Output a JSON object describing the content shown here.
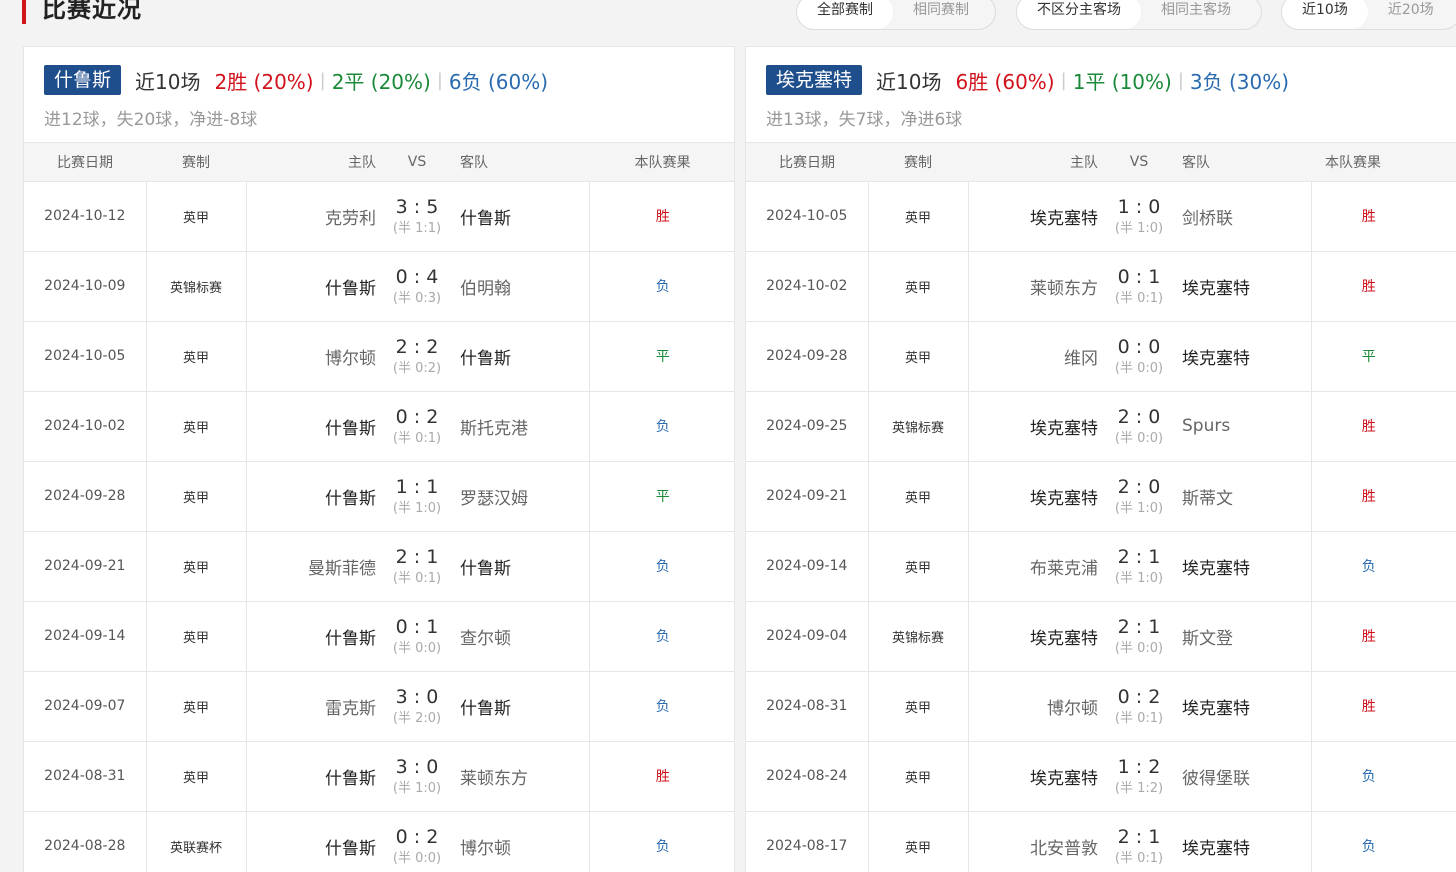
{
  "section_title": "比赛近况",
  "filters": [
    {
      "options": [
        "全部赛制",
        "相同赛制"
      ],
      "active": 0
    },
    {
      "options": [
        "不区分主客场",
        "相同主客场"
      ],
      "active": 0
    },
    {
      "options": [
        "近10场",
        "近20场"
      ],
      "active": 0
    }
  ],
  "columns": {
    "date": "比赛日期",
    "competition": "赛制",
    "home": "主队",
    "vs": "VS",
    "away": "客队",
    "result": "本队赛果"
  },
  "panels": [
    {
      "team": "什鲁斯",
      "games_label": "近10场",
      "wins": "2胜 (20%)",
      "draws": "2平 (20%)",
      "losses": "6负 (60%)",
      "goals": "进12球，失20球，净进-8球",
      "matches": [
        {
          "date": "2024-10-12",
          "comp": "英甲",
          "home": "克劳利",
          "score": "3 : 5",
          "half": "(半 1:1)",
          "away": "什鲁斯",
          "result": "胜",
          "r": "W",
          "self": "away"
        },
        {
          "date": "2024-10-09",
          "comp": "英锦标赛",
          "home": "什鲁斯",
          "score": "0 : 4",
          "half": "(半 0:3)",
          "away": "伯明翰",
          "result": "负",
          "r": "L",
          "self": "home"
        },
        {
          "date": "2024-10-05",
          "comp": "英甲",
          "home": "博尔顿",
          "score": "2 : 2",
          "half": "(半 0:2)",
          "away": "什鲁斯",
          "result": "平",
          "r": "D",
          "self": "away"
        },
        {
          "date": "2024-10-02",
          "comp": "英甲",
          "home": "什鲁斯",
          "score": "0 : 2",
          "half": "(半 0:1)",
          "away": "斯托克港",
          "result": "负",
          "r": "L",
          "self": "home"
        },
        {
          "date": "2024-09-28",
          "comp": "英甲",
          "home": "什鲁斯",
          "score": "1 : 1",
          "half": "(半 1:0)",
          "away": "罗瑟汉姆",
          "result": "平",
          "r": "D",
          "self": "home"
        },
        {
          "date": "2024-09-21",
          "comp": "英甲",
          "home": "曼斯菲德",
          "score": "2 : 1",
          "half": "(半 0:1)",
          "away": "什鲁斯",
          "result": "负",
          "r": "L",
          "self": "away"
        },
        {
          "date": "2024-09-14",
          "comp": "英甲",
          "home": "什鲁斯",
          "score": "0 : 1",
          "half": "(半 0:0)",
          "away": "查尔顿",
          "result": "负",
          "r": "L",
          "self": "home"
        },
        {
          "date": "2024-09-07",
          "comp": "英甲",
          "home": "雷克斯",
          "score": "3 : 0",
          "half": "(半 2:0)",
          "away": "什鲁斯",
          "result": "负",
          "r": "L",
          "self": "away"
        },
        {
          "date": "2024-08-31",
          "comp": "英甲",
          "home": "什鲁斯",
          "score": "3 : 0",
          "half": "(半 1:0)",
          "away": "莱顿东方",
          "result": "胜",
          "r": "W",
          "self": "home"
        },
        {
          "date": "2024-08-28",
          "comp": "英联赛杯",
          "home": "什鲁斯",
          "score": "0 : 2",
          "half": "(半 0:0)",
          "away": "博尔顿",
          "result": "负",
          "r": "L",
          "self": "home"
        }
      ]
    },
    {
      "team": "埃克塞特",
      "games_label": "近10场",
      "wins": "6胜 (60%)",
      "draws": "1平 (10%)",
      "losses": "3负 (30%)",
      "goals": "进13球，失7球，净进6球",
      "matches": [
        {
          "date": "2024-10-05",
          "comp": "英甲",
          "home": "埃克塞特",
          "score": "1 : 0",
          "half": "(半 1:0)",
          "away": "剑桥联",
          "result": "胜",
          "r": "W",
          "self": "home"
        },
        {
          "date": "2024-10-02",
          "comp": "英甲",
          "home": "莱顿东方",
          "score": "0 : 1",
          "half": "(半 0:1)",
          "away": "埃克塞特",
          "result": "胜",
          "r": "W",
          "self": "away"
        },
        {
          "date": "2024-09-28",
          "comp": "英甲",
          "home": "维冈",
          "score": "0 : 0",
          "half": "(半 0:0)",
          "away": "埃克塞特",
          "result": "平",
          "r": "D",
          "self": "away"
        },
        {
          "date": "2024-09-25",
          "comp": "英锦标赛",
          "home": "埃克塞特",
          "score": "2 : 0",
          "half": "(半 0:0)",
          "away": "Spurs",
          "result": "胜",
          "r": "W",
          "self": "home"
        },
        {
          "date": "2024-09-21",
          "comp": "英甲",
          "home": "埃克塞特",
          "score": "2 : 0",
          "half": "(半 1:0)",
          "away": "斯蒂文",
          "result": "胜",
          "r": "W",
          "self": "home"
        },
        {
          "date": "2024-09-14",
          "comp": "英甲",
          "home": "布莱克浦",
          "score": "2 : 1",
          "half": "(半 1:0)",
          "away": "埃克塞特",
          "result": "负",
          "r": "L",
          "self": "away"
        },
        {
          "date": "2024-09-04",
          "comp": "英锦标赛",
          "home": "埃克塞特",
          "score": "2 : 1",
          "half": "(半 0:0)",
          "away": "斯文登",
          "result": "胜",
          "r": "W",
          "self": "home"
        },
        {
          "date": "2024-08-31",
          "comp": "英甲",
          "home": "博尔顿",
          "score": "0 : 2",
          "half": "(半 0:1)",
          "away": "埃克塞特",
          "result": "胜",
          "r": "W",
          "self": "away"
        },
        {
          "date": "2024-08-24",
          "comp": "英甲",
          "home": "埃克塞特",
          "score": "1 : 2",
          "half": "(半 1:2)",
          "away": "彼得堡联",
          "result": "负",
          "r": "L",
          "self": "home"
        },
        {
          "date": "2024-08-17",
          "comp": "英甲",
          "home": "北安普敦",
          "score": "2 : 1",
          "half": "(半 0:1)",
          "away": "埃克塞特",
          "result": "负",
          "r": "L",
          "self": "away"
        }
      ]
    }
  ]
}
